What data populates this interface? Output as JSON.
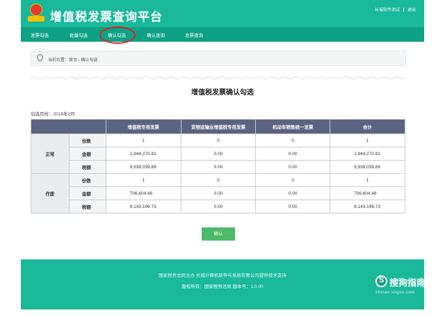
{
  "header": {
    "app_title": "增值税发票查询平台",
    "user_name": "长城软件测试",
    "logout_label": "退出"
  },
  "nav": {
    "items": [
      {
        "label": "发票勾选"
      },
      {
        "label": "批量勾选"
      },
      {
        "label": "确认勾选"
      },
      {
        "label": "确认查询"
      },
      {
        "label": "发票查询"
      }
    ],
    "active_index": 2
  },
  "breadcrumb": {
    "text": "当前位置：首页 - 确认勾选"
  },
  "page": {
    "title": "增值税发票确认勾选",
    "month_label": "勾选月份：2016年2月"
  },
  "table": {
    "headers": [
      "",
      "",
      "增值税专用发票",
      "货物运输业增值税专用发票",
      "机动车销售统一发票",
      "合计"
    ],
    "groups": [
      {
        "name": "正常",
        "rows": [
          {
            "label": "份数",
            "values": [
              "1",
              "0",
              "0",
              "1"
            ]
          },
          {
            "label": "金额",
            "values": [
              "2,944,270.82",
              "0.00",
              "0.00",
              "2,944,270.82"
            ]
          },
          {
            "label": "税额",
            "values": [
              "9,938,039.89",
              "0.00",
              "0.00",
              "9,938,039.89"
            ]
          }
        ]
      },
      {
        "name": "作废",
        "rows": [
          {
            "label": "份数",
            "values": [
              "1",
              "0",
              "0",
              "1"
            ]
          },
          {
            "label": "金额",
            "values": [
              "706,604.46",
              "0.00",
              "0.00",
              "706,604.46"
            ]
          },
          {
            "label": "税额",
            "values": [
              "8,143,196.73",
              "0.00",
              "0.00",
              "8,143,196.73"
            ]
          }
        ]
      }
    ]
  },
  "confirm_button_label": "确认",
  "footer": {
    "line1": "国家税务总局主办 长城计算机软件与系统有限公司提供技术支持",
    "line2": "版权所有：国家税务总局 版本号：1.0.00"
  },
  "watermark": {
    "brand": "搜狗指南",
    "url": "zhinan.sogou.com"
  },
  "colors": {
    "header_bg": "#19b99a",
    "nav_bg": "#0ea183",
    "table_header_bg": "#5a6480",
    "confirm_button_bg": "#4cba69",
    "highlight_ring": "#d8232a"
  }
}
